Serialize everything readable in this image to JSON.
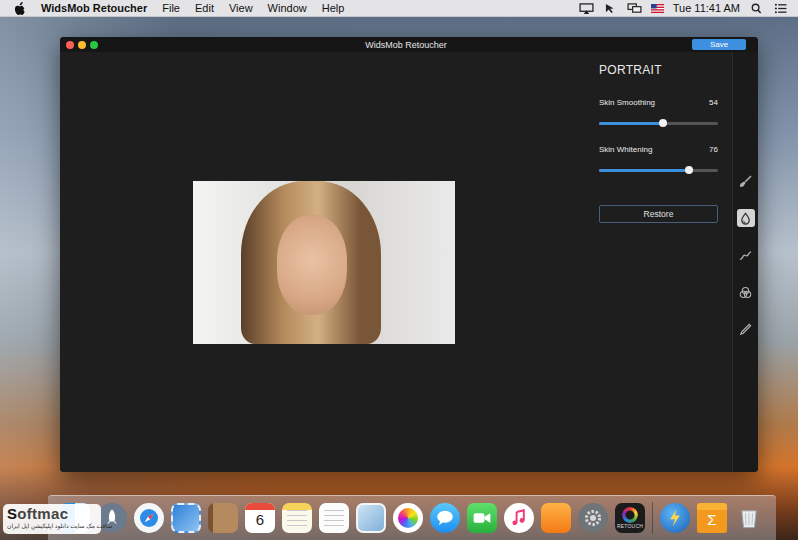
{
  "menubar": {
    "app": "WidsMob Retoucher",
    "menus": [
      "File",
      "Edit",
      "View",
      "Window",
      "Help"
    ],
    "status_items": [
      {
        "kind": "airplay"
      },
      {
        "kind": "cursor"
      },
      {
        "kind": "display"
      },
      {
        "kind": "flag"
      },
      {
        "kind": "clock",
        "text": "Tue 11:41 AM"
      },
      {
        "kind": "search"
      },
      {
        "kind": "list"
      }
    ]
  },
  "window": {
    "title": "WidsMob Retoucher",
    "save": "Save"
  },
  "panel": {
    "heading": "PORTRAIT",
    "sliders": [
      {
        "label": "Skin Smoothing",
        "reading": "54",
        "level": 0.54
      },
      {
        "label": "Skin Whitening",
        "reading": "76",
        "level": 0.76
      }
    ],
    "restore": "Restore"
  },
  "tools": [
    {
      "kind": "brush",
      "selected": false
    },
    {
      "kind": "drop",
      "selected": true
    },
    {
      "kind": "curve",
      "selected": false
    },
    {
      "kind": "circles",
      "selected": false
    },
    {
      "kind": "pencil",
      "selected": false
    }
  ],
  "dock": [
    {
      "kind": "finder"
    },
    {
      "kind": "launchpad"
    },
    {
      "kind": "safari"
    },
    {
      "kind": "mail"
    },
    {
      "kind": "contacts"
    },
    {
      "kind": "calendar",
      "text": "6"
    },
    {
      "kind": "notes"
    },
    {
      "kind": "reminders"
    },
    {
      "kind": "preview"
    },
    {
      "kind": "photos"
    },
    {
      "kind": "messages"
    },
    {
      "kind": "facetime"
    },
    {
      "kind": "itunes"
    },
    {
      "kind": "ibooks"
    },
    {
      "kind": "sysprefs"
    },
    {
      "kind": "retouch",
      "text": "RETOUCH"
    },
    {
      "kind": "separator"
    },
    {
      "kind": "app"
    },
    {
      "kind": "folder",
      "text": "Σ"
    },
    {
      "kind": "trash"
    }
  ],
  "watermark": {
    "logo": "Softmac",
    "tagline": "سافت مک سایت دانلود اپلیکیشن اپل ایران"
  }
}
